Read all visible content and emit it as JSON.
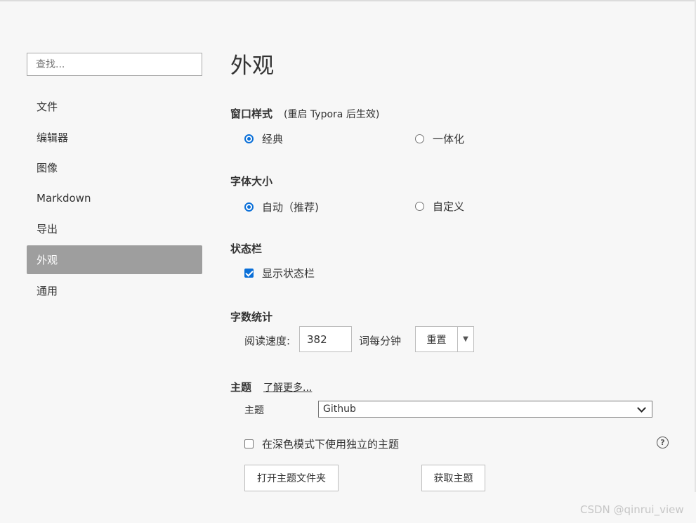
{
  "sidebar": {
    "search_placeholder": "查找...",
    "items": [
      {
        "label": "文件"
      },
      {
        "label": "编辑器"
      },
      {
        "label": "图像"
      },
      {
        "label": "Markdown"
      },
      {
        "label": "导出"
      },
      {
        "label": "外观",
        "active": true
      },
      {
        "label": "通用"
      }
    ]
  },
  "main": {
    "title": "外观",
    "window_style": {
      "title": "窗口样式",
      "note": "(重启 Typora 后生效)",
      "options": [
        "经典",
        "一体化"
      ],
      "selected": "经典"
    },
    "font_size": {
      "title": "字体大小",
      "options": [
        "自动（推荐)",
        "自定义"
      ],
      "selected": "自动（推荐)"
    },
    "status_bar": {
      "title": "状态栏",
      "checkbox_label": "显示状态栏",
      "checked": true
    },
    "word_count": {
      "title": "字数统计",
      "speed_label": "阅读速度:",
      "speed_value": "382",
      "unit_label": "词每分钟",
      "reset_label": "重置",
      "dropdown_glyph": "▼"
    },
    "theme": {
      "title": "主题",
      "learn_more": "了解更多...",
      "theme_label": "主题",
      "theme_value": "Github",
      "dark_mode_label": "在深色模式下使用独立的主题",
      "dark_mode_checked": false,
      "help_glyph": "?",
      "open_folder_button": "打开主题文件夹",
      "get_themes_button": "获取主题"
    }
  },
  "watermark": "CSDN @qinrui_view",
  "colors": {
    "accent": "#0a6fd8",
    "active_nav_bg": "#9e9e9e",
    "background": "#f7f7f7"
  },
  "icons": {
    "chevron": "chevron-down-icon",
    "help": "help-circle-icon",
    "reset_dropdown": "triangle-down-icon"
  }
}
